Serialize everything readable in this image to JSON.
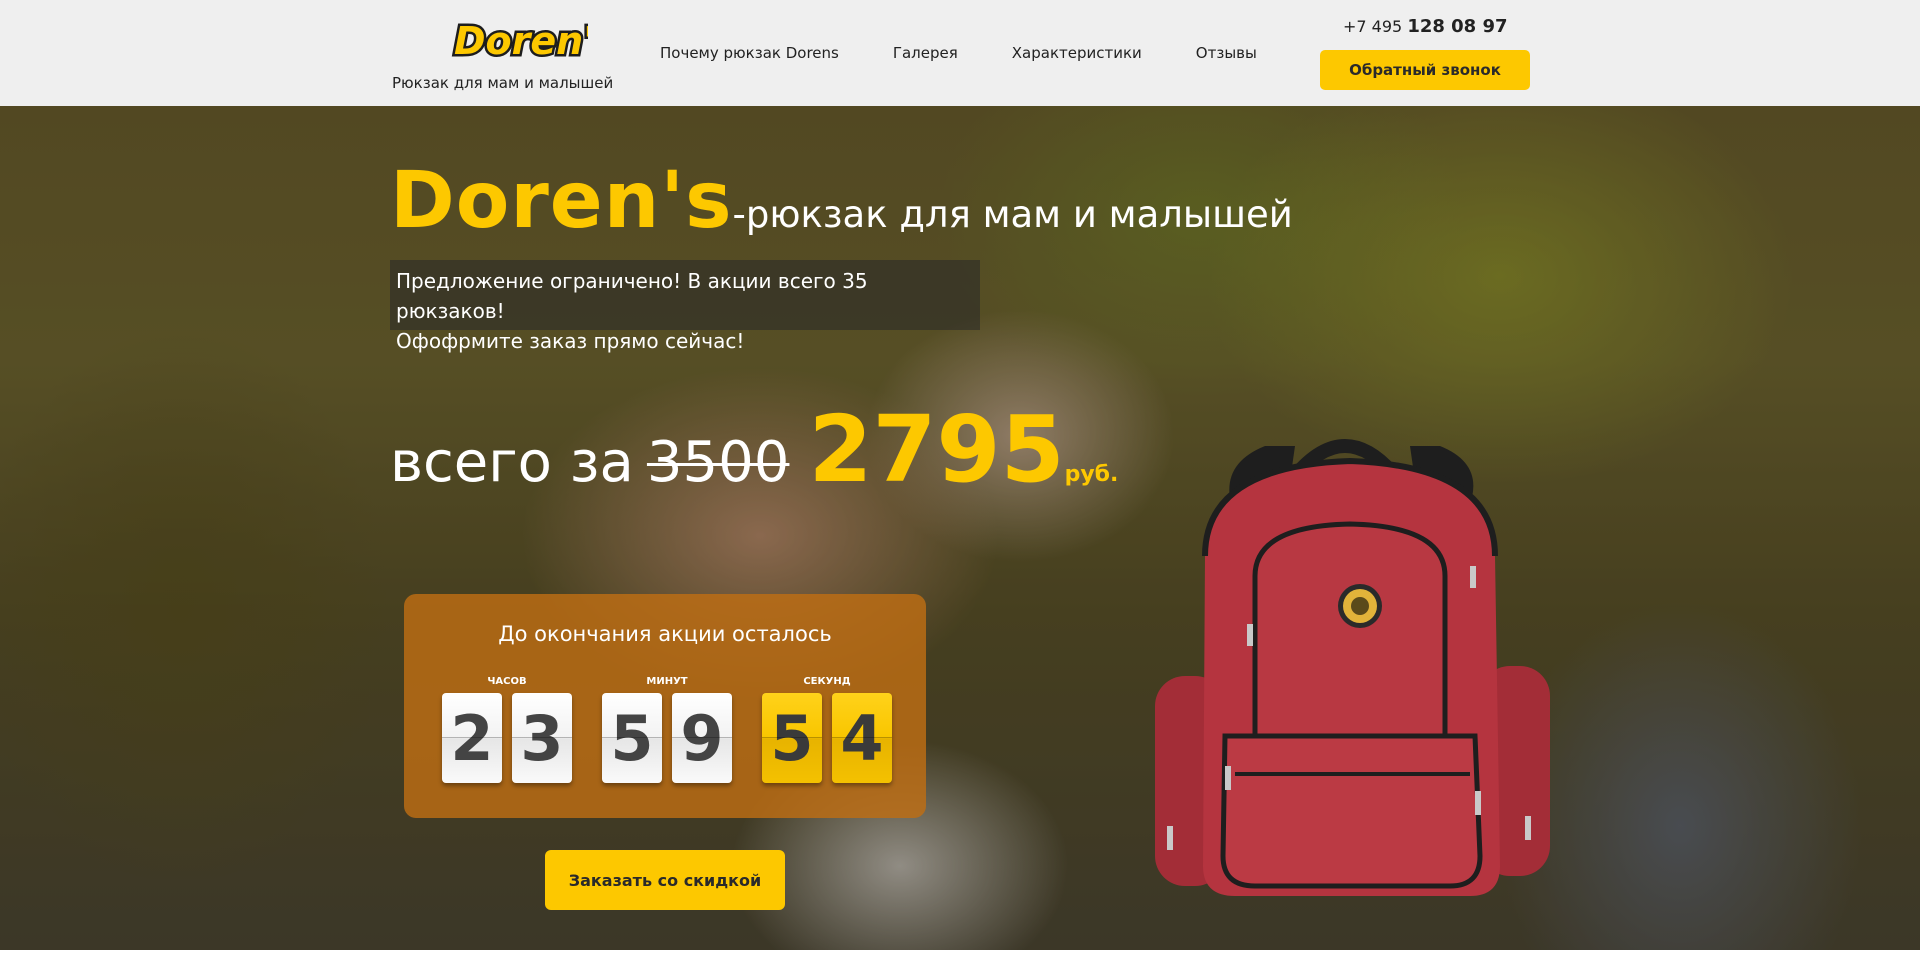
{
  "header": {
    "logo_text": "Doren's",
    "tagline": "Рюкзак для мам и малышей",
    "nav": [
      {
        "label": "Почему рюкзак Dorens"
      },
      {
        "label": "Галерея"
      },
      {
        "label": "Характеристики"
      },
      {
        "label": "Отзывы"
      }
    ],
    "phone_prefix": "+7 495",
    "phone_number": "128 08 97",
    "callback_label": "Обратный звонок"
  },
  "hero": {
    "brand": "Doren's",
    "title_rest": "-рюкзак для мам и малышей",
    "notice_line1": "Предложение ограничено! В акции всего 35 рюкзаков!",
    "notice_line2": "Офофрмите заказ прямо сейчас!",
    "price_label": "всего за",
    "old_price": "3500",
    "new_price": "2795",
    "currency": "руб.",
    "order_button": "Заказать со скидкой"
  },
  "timer": {
    "title": "До окончания акции осталось",
    "hours_label": "ЧАСОВ",
    "minutes_label": "МИНУТ",
    "seconds_label": "СЕКУНД",
    "hours": [
      "2",
      "3"
    ],
    "minutes": [
      "5",
      "9"
    ],
    "seconds": [
      "5",
      "4"
    ]
  },
  "colors": {
    "accent": "#fdc800",
    "header_bg": "#efefef",
    "timer_bg": "#be6e14",
    "backpack": "#b5343f"
  }
}
